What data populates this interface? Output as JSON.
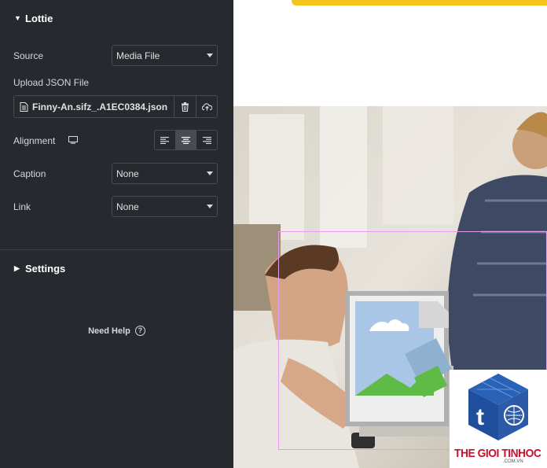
{
  "panel": {
    "lottie_section": "Lottie",
    "source_label": "Source",
    "source_value": "Media File",
    "upload_label": "Upload JSON File",
    "file_name": "Finny-An.sifz_.A1EC0384.json",
    "alignment_label": "Alignment",
    "alignment_selected": "center",
    "caption_label": "Caption",
    "caption_value": "None",
    "link_label": "Link",
    "link_value": "None",
    "settings_section": "Settings",
    "help_label": "Need Help",
    "help_icon_glyph": "?"
  },
  "watermark": {
    "brand": "THE GIOI TINHOC",
    "domain": ".COM.VN",
    "cube_letter": "t"
  },
  "colors": {
    "panel_bg": "#26292e",
    "accent_yellow": "#f5c41a",
    "selection_outline": "#e79cef",
    "brand_red": "#c8102e",
    "brand_blue": "#1f4e9c"
  }
}
